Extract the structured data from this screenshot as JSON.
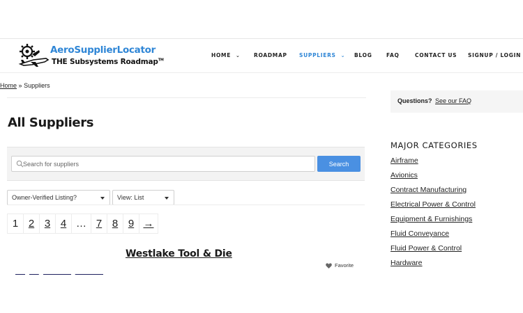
{
  "header": {
    "logo_title": "AeroSupplierLocator",
    "logo_subtitle": "THE Subsystems Roadmap",
    "logo_tm": "TM",
    "brand_color": "#2f86d6"
  },
  "nav": {
    "items": [
      {
        "label": "HOME",
        "has_dropdown": true
      },
      {
        "label": "ROADMAP",
        "has_dropdown": false
      },
      {
        "label": "SUPPLIERS",
        "has_dropdown": true,
        "active": true
      },
      {
        "label": "BLOG",
        "has_dropdown": false
      },
      {
        "label": "FAQ",
        "has_dropdown": false
      },
      {
        "label": "CONTACT US",
        "has_dropdown": false
      },
      {
        "label": "SIGNUP / LOGIN",
        "has_dropdown": true
      }
    ],
    "dropdown_icon": "chevron-down-icon"
  },
  "breadcrumb": {
    "home": "Home",
    "separator": "»",
    "current": "Suppliers"
  },
  "main": {
    "title": "All Suppliers",
    "search": {
      "placeholder": "Search for suppliers",
      "value": "",
      "button_label": "Search",
      "button_color": "#4a90e2"
    },
    "filters": {
      "listing": "Owner-Verified Listing?",
      "view": "View: List"
    },
    "pagination": {
      "pages": [
        "1",
        "2",
        "3",
        "4",
        "…",
        "7",
        "8",
        "9",
        "→"
      ],
      "current": "1"
    },
    "results": [
      {
        "name": "Westlake Tool & Die",
        "favorite_label": "Favorite"
      }
    ]
  },
  "sidebar": {
    "faq_question": "Questions?",
    "faq_link": "See our FAQ",
    "categories_heading": "MAJOR CATEGORIES",
    "categories": [
      "Airframe",
      "Avionics",
      "Contract Manufacturing",
      "Electrical Power & Control",
      "Equipment & Furnishings",
      "Fluid Conveyance",
      "Fluid Power & Control",
      "Hardware"
    ]
  }
}
